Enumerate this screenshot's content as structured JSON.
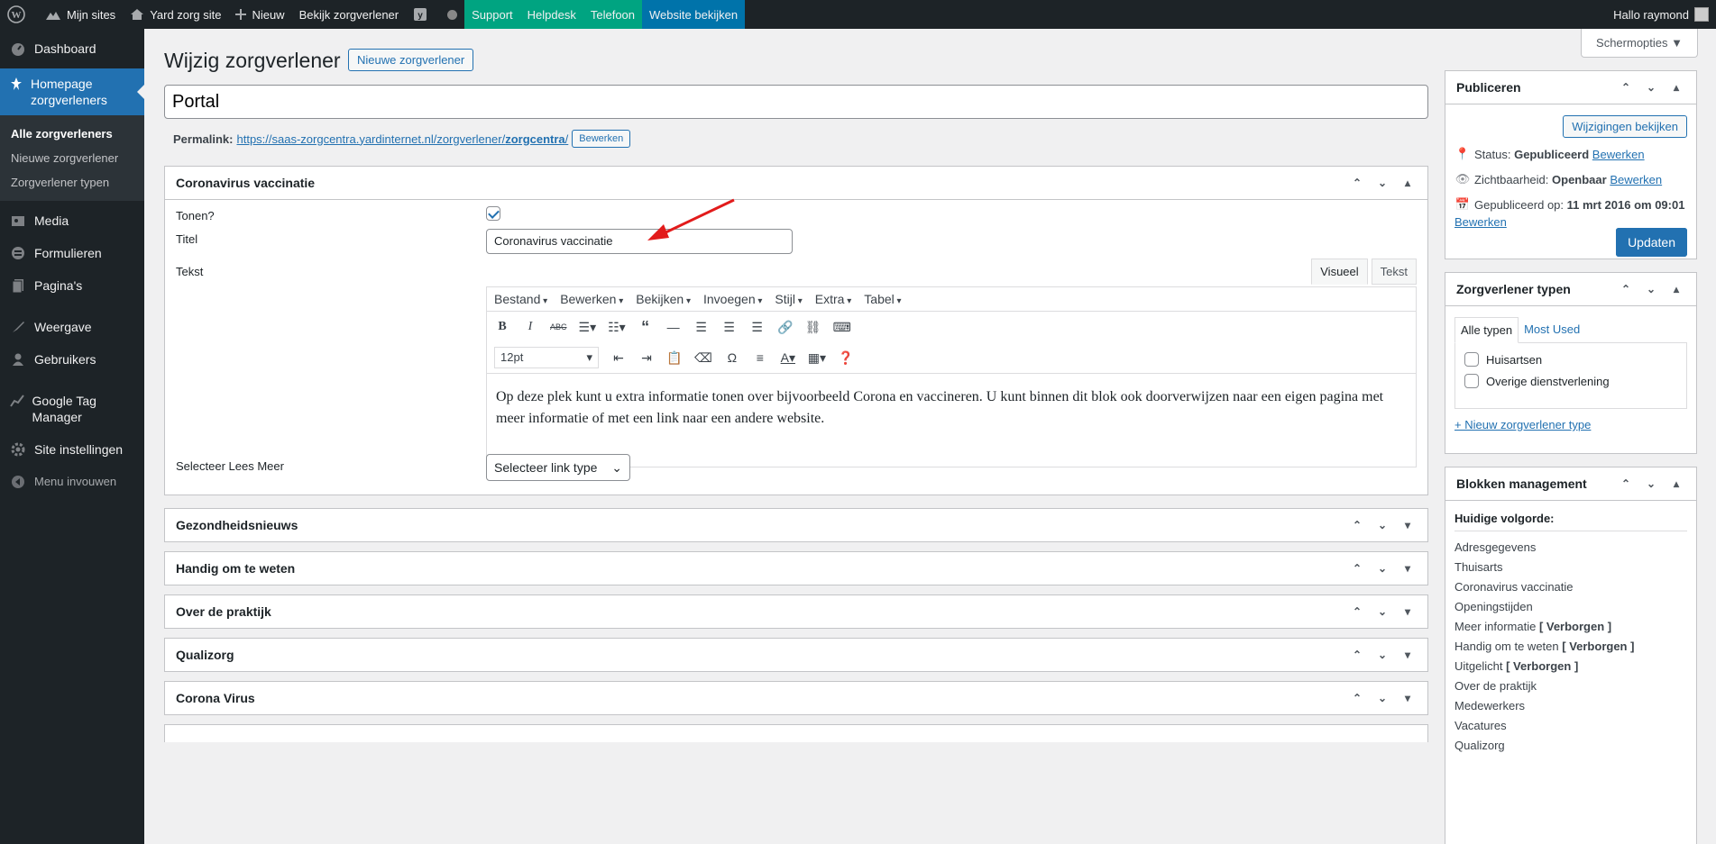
{
  "adminbar": {
    "items": [
      "Mijn sites",
      "Yard zorg site",
      "Nieuw",
      "Bekijk zorgverlener"
    ],
    "green_items": [
      "Support",
      "Helpdesk",
      "Telefoon"
    ],
    "blue_item": "Website bekijken",
    "greeting": "Hallo raymond"
  },
  "sidebar": {
    "dashboard": "Dashboard",
    "current": "Homepage zorgverleners",
    "sub": [
      "Alle zorgverleners",
      "Nieuwe zorgverlener",
      "Zorgverlener typen"
    ],
    "items": [
      "Media",
      "Formulieren",
      "Pagina's",
      "Weergave",
      "Gebruikers",
      "Google Tag Manager",
      "Site instellingen"
    ],
    "collapse": "Menu invouwen"
  },
  "header": {
    "screen_options": "Schermopties ▼",
    "title": "Wijzig zorgverlener",
    "new_button": "Nieuwe zorgverlener",
    "post_title": "Portal",
    "permalink_label": "Permalink:",
    "permalink_base": "https://saas-zorgcentra.yardinternet.nl/zorgverlener/",
    "permalink_slug": "zorgcentra",
    "permalink_end": "/",
    "permalink_edit": "Bewerken"
  },
  "corona_box": {
    "title": "Coronavirus vaccinatie",
    "show_label": "Tonen?",
    "show_checked": true,
    "title_label": "Titel",
    "title_value": "Coronavirus vaccinatie",
    "text_label": "Tekst",
    "tab_visual": "Visueel",
    "tab_text": "Tekst",
    "menus": [
      "Bestand",
      "Bewerken",
      "Bekijken",
      "Invoegen",
      "Stijl",
      "Extra",
      "Tabel"
    ],
    "font_size": "12pt",
    "content": "Op deze plek kunt u extra informatie tonen over bijvoorbeeld Corona en vaccineren. U kunt binnen dit blok ook doorverwijzen naar een eigen pagina met meer informatie of met een link naar een andere website.",
    "read_more_label": "Selecteer Lees Meer",
    "read_more_value": "Selecteer link type"
  },
  "collapsed_boxes": [
    "Gezondheidsnieuws",
    "Handig om te weten",
    "Over de praktijk",
    "Qualizorg",
    "Corona Virus"
  ],
  "publish": {
    "title": "Publiceren",
    "preview": "Wijzigingen bekijken",
    "status_label": "Status:",
    "status_value": "Gepubliceerd",
    "visibility_label": "Zichtbaarheid:",
    "visibility_value": "Openbaar",
    "published_label": "Gepubliceerd op:",
    "published_value": "11 mrt 2016 om 09:01",
    "edit": "Bewerken",
    "update": "Updaten"
  },
  "types": {
    "title": "Zorgverlener typen",
    "tab_all": "Alle typen",
    "tab_used": "Most Used",
    "options": [
      "Huisartsen",
      "Overige dienstverlening"
    ],
    "add_link": "+ Nieuw zorgverlener type"
  },
  "blocks": {
    "title": "Blokken management",
    "heading": "Huidige volgorde:",
    "order": [
      {
        "name": "Adresgegevens",
        "hidden": ""
      },
      {
        "name": "Thuisarts",
        "hidden": ""
      },
      {
        "name": "Coronavirus vaccinatie",
        "hidden": ""
      },
      {
        "name": "Openingstijden",
        "hidden": ""
      },
      {
        "name": "Meer informatie",
        "hidden": "[ Verborgen ]"
      },
      {
        "name": "Handig om te weten",
        "hidden": "[ Verborgen ]"
      },
      {
        "name": "Uitgelicht",
        "hidden": "[ Verborgen ]"
      },
      {
        "name": "Over de praktijk",
        "hidden": ""
      },
      {
        "name": "Medewerkers",
        "hidden": ""
      },
      {
        "name": "Vacatures",
        "hidden": ""
      },
      {
        "name": "Qualizorg",
        "hidden": ""
      }
    ]
  }
}
